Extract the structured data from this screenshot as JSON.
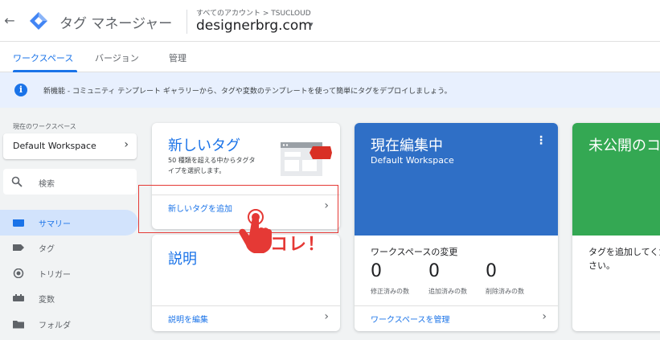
{
  "header": {
    "back_icon": "arrow-back-icon",
    "app_title": "タグ マネージャー",
    "breadcrumb": "すべてのアカウント > TSUCLOUD",
    "container_name": "designerbrg.com",
    "container_caret": "▾"
  },
  "tabs": [
    {
      "label": "ワークスペース",
      "active": true
    },
    {
      "label": "バージョン",
      "active": false
    },
    {
      "label": "管理",
      "active": false
    }
  ],
  "banner": {
    "icon": "info-icon",
    "text": "新機能 - コミュニティ テンプレート ギャラリーから、タグや変数のテンプレートを使って簡単にタグをデプロイしましょう。"
  },
  "sidebar": {
    "workspace_label": "現在のワークスペース",
    "workspace_name": "Default Workspace",
    "search_placeholder": "検索",
    "items": [
      {
        "label": "サマリー",
        "icon": "summary-icon",
        "active": true
      },
      {
        "label": "タグ",
        "icon": "tag-icon",
        "active": false
      },
      {
        "label": "トリガー",
        "icon": "trigger-icon",
        "active": false
      },
      {
        "label": "変数",
        "icon": "variables-icon",
        "active": false
      },
      {
        "label": "フォルダ",
        "icon": "folder-icon",
        "active": false
      }
    ]
  },
  "cards": {
    "new_tag": {
      "title": "新しいタグ",
      "description": "50 種類を超える中からタグタイプを選択します。",
      "link": "新しいタグを追加"
    },
    "description": {
      "title": "説明",
      "link": "説明を編集"
    },
    "current_editing": {
      "title": "現在編集中",
      "subtitle": "Default Workspace",
      "changes_title": "ワークスペースの変更",
      "stats": [
        {
          "value": "0",
          "label": "修正済みの数"
        },
        {
          "value": "0",
          "label": "追加済みの数"
        },
        {
          "value": "0",
          "label": "削除済みの数"
        }
      ],
      "link": "ワークスペースを管理"
    },
    "unpublished": {
      "title": "未公開のコ",
      "text": "タグを追加してください。"
    }
  },
  "annotation": {
    "callout": "コレ！"
  },
  "colors": {
    "accent": "#1a73e8",
    "current_card": "#2f6fc6",
    "unpublished_card": "#34a853",
    "annotation": "#e53935",
    "banner": "#e8f0fe"
  }
}
